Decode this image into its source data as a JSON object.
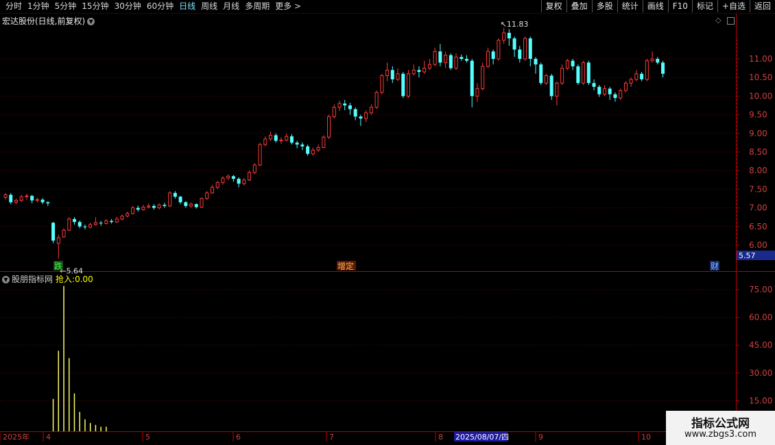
{
  "toolbar": {
    "periods": [
      "分时",
      "1分钟",
      "5分钟",
      "15分钟",
      "30分钟",
      "60分钟",
      "日线",
      "周线",
      "月线",
      "多周期",
      "更多 >"
    ],
    "active_period": "日线",
    "buttons": [
      "复权",
      "叠加",
      "多股",
      "统计",
      "画线",
      "F10",
      "标记",
      "+自选",
      "返回"
    ]
  },
  "chart_title": "宏达股份(日线,前复权)",
  "indicator": {
    "name": "股朋指标网",
    "label": "抢入:",
    "value": "0.00"
  },
  "price_axis_labels": [
    "11.00",
    "10.50",
    "10.00",
    "9.50",
    "9.00",
    "8.50",
    "8.00",
    "7.50",
    "7.00",
    "6.50",
    "6.00"
  ],
  "indicator_axis_labels": [
    "75.00",
    "60.00",
    "45.00",
    "30.00",
    "15.00"
  ],
  "current_price_tag": "5.57",
  "high_annotation": "11.83",
  "low_annotation": "5.64",
  "markers": {
    "die": "跌",
    "zengding": "增定",
    "cai": "财"
  },
  "date_axis": {
    "labels": [
      "2025年",
      "4",
      "5",
      "6",
      "7",
      "8",
      "9",
      "10"
    ],
    "cursor_date": "2025/08/07/四"
  },
  "watermark": {
    "line1": "指标公式网",
    "line2": "www.zbgs3.com"
  },
  "colors": {
    "up": "#ff3b3b",
    "down": "#54ffff",
    "grid": "#7a0000",
    "axis": "#c00000",
    "volume": "#ffff66"
  },
  "chart_data": {
    "type": "candlestick",
    "y_axis": {
      "min": 5.5,
      "max": 12.0
    },
    "candles": [
      [
        7.28,
        7.35,
        7.22,
        7.4
      ],
      [
        7.35,
        7.15,
        7.1,
        7.4
      ],
      [
        7.15,
        7.2,
        7.1,
        7.25
      ],
      [
        7.2,
        7.3,
        7.15,
        7.35
      ],
      [
        7.3,
        7.32,
        7.22,
        7.38
      ],
      [
        7.32,
        7.2,
        7.12,
        7.35
      ],
      [
        7.2,
        7.22,
        7.15,
        7.28
      ],
      [
        7.22,
        7.15,
        7.1,
        7.26
      ],
      [
        7.15,
        7.12,
        7.05,
        7.18
      ],
      [
        6.6,
        6.12,
        6.05,
        6.62
      ],
      [
        6.05,
        6.2,
        5.64,
        6.28
      ],
      [
        6.22,
        6.4,
        6.2,
        6.45
      ],
      [
        6.4,
        6.7,
        6.38,
        6.75
      ],
      [
        6.7,
        6.62,
        6.55,
        6.75
      ],
      [
        6.62,
        6.5,
        6.45,
        6.66
      ],
      [
        6.5,
        6.48,
        6.42,
        6.55
      ],
      [
        6.48,
        6.55,
        6.45,
        6.6
      ],
      [
        6.55,
        6.6,
        6.52,
        6.75
      ],
      [
        6.6,
        6.58,
        6.52,
        6.65
      ],
      [
        6.58,
        6.65,
        6.55,
        6.7
      ],
      [
        6.65,
        6.62,
        6.58,
        6.7
      ],
      [
        6.62,
        6.7,
        6.6,
        6.76
      ],
      [
        6.7,
        6.78,
        6.66,
        6.82
      ],
      [
        6.78,
        6.85,
        6.74,
        6.9
      ],
      [
        6.85,
        7.0,
        6.82,
        7.05
      ],
      [
        7.0,
        6.95,
        6.9,
        7.06
      ],
      [
        6.95,
        7.02,
        6.92,
        7.08
      ],
      [
        7.02,
        7.05,
        6.98,
        7.12
      ],
      [
        7.05,
        7.0,
        6.95,
        7.1
      ],
      [
        7.0,
        7.08,
        6.96,
        7.12
      ],
      [
        7.08,
        7.05,
        7.0,
        7.14
      ],
      [
        7.05,
        7.4,
        7.02,
        7.45
      ],
      [
        7.4,
        7.3,
        7.25,
        7.45
      ],
      [
        7.3,
        7.15,
        7.1,
        7.32
      ],
      [
        7.15,
        7.05,
        7.0,
        7.18
      ],
      [
        7.05,
        7.1,
        7.0,
        7.15
      ],
      [
        7.1,
        7.02,
        6.98,
        7.12
      ],
      [
        7.02,
        7.25,
        7.0,
        7.28
      ],
      [
        7.25,
        7.4,
        7.22,
        7.45
      ],
      [
        7.4,
        7.55,
        7.38,
        7.62
      ],
      [
        7.55,
        7.68,
        7.5,
        7.72
      ],
      [
        7.68,
        7.8,
        7.62,
        7.85
      ],
      [
        7.8,
        7.85,
        7.75,
        7.9
      ],
      [
        7.85,
        7.78,
        7.7,
        7.88
      ],
      [
        7.78,
        7.65,
        7.55,
        7.82
      ],
      [
        7.65,
        7.75,
        7.6,
        7.8
      ],
      [
        7.75,
        7.95,
        7.72,
        8.0
      ],
      [
        7.95,
        8.15,
        7.9,
        8.2
      ],
      [
        8.15,
        8.7,
        8.12,
        8.75
      ],
      [
        8.7,
        8.85,
        8.65,
        8.92
      ],
      [
        8.85,
        8.95,
        8.8,
        9.05
      ],
      [
        8.95,
        8.8,
        8.75,
        9.0
      ],
      [
        8.8,
        8.82,
        8.72,
        8.9
      ],
      [
        8.82,
        8.92,
        8.78,
        9.0
      ],
      [
        8.92,
        8.75,
        8.7,
        8.98
      ],
      [
        8.75,
        8.7,
        8.6,
        8.8
      ],
      [
        8.7,
        8.65,
        8.55,
        8.76
      ],
      [
        8.65,
        8.45,
        8.4,
        8.7
      ],
      [
        8.45,
        8.55,
        8.4,
        8.62
      ],
      [
        8.55,
        8.62,
        8.5,
        8.7
      ],
      [
        8.62,
        8.9,
        8.6,
        8.95
      ],
      [
        8.9,
        9.45,
        8.85,
        9.5
      ],
      [
        9.45,
        9.7,
        9.4,
        9.78
      ],
      [
        9.7,
        9.8,
        9.6,
        9.88
      ],
      [
        9.8,
        9.75,
        9.62,
        9.9
      ],
      [
        9.75,
        9.65,
        9.5,
        9.82
      ],
      [
        9.65,
        9.45,
        9.35,
        9.7
      ],
      [
        9.45,
        9.4,
        9.2,
        9.5
      ],
      [
        9.4,
        9.55,
        9.3,
        9.62
      ],
      [
        9.55,
        9.7,
        9.5,
        9.78
      ],
      [
        9.7,
        10.1,
        9.65,
        10.15
      ],
      [
        10.1,
        10.55,
        10.05,
        10.6
      ],
      [
        10.55,
        10.7,
        10.4,
        10.9
      ],
      [
        10.7,
        10.45,
        10.35,
        10.8
      ],
      [
        10.45,
        10.6,
        10.4,
        10.75
      ],
      [
        10.6,
        10.0,
        9.95,
        10.65
      ],
      [
        10.0,
        10.6,
        9.95,
        10.7
      ],
      [
        10.6,
        10.7,
        10.55,
        10.85
      ],
      [
        10.7,
        10.65,
        10.5,
        10.8
      ],
      [
        10.65,
        10.75,
        10.6,
        10.95
      ],
      [
        10.75,
        10.85,
        10.7,
        11.0
      ],
      [
        10.85,
        11.2,
        10.8,
        11.3
      ],
      [
        11.2,
        10.9,
        10.8,
        11.4
      ],
      [
        10.9,
        11.1,
        10.75,
        11.2
      ],
      [
        11.1,
        10.75,
        10.7,
        11.15
      ],
      [
        10.75,
        11.05,
        10.7,
        11.15
      ],
      [
        11.05,
        11.0,
        10.95,
        11.12
      ],
      [
        11.0,
        10.95,
        10.9,
        11.1
      ],
      [
        10.95,
        10.0,
        9.7,
        11.0
      ],
      [
        10.0,
        10.2,
        9.85,
        10.35
      ],
      [
        10.2,
        10.8,
        10.15,
        10.9
      ],
      [
        10.8,
        11.2,
        10.75,
        11.3
      ],
      [
        11.2,
        11.0,
        10.85,
        11.25
      ],
      [
        11.0,
        11.5,
        10.95,
        11.55
      ],
      [
        11.5,
        11.7,
        11.4,
        11.83
      ],
      [
        11.7,
        11.55,
        11.35,
        11.8
      ],
      [
        11.55,
        11.25,
        11.05,
        11.6
      ],
      [
        11.25,
        11.0,
        10.9,
        11.35
      ],
      [
        11.0,
        11.55,
        10.95,
        11.6
      ],
      [
        11.55,
        11.0,
        10.8,
        11.6
      ],
      [
        11.0,
        10.85,
        10.6,
        11.05
      ],
      [
        10.85,
        10.35,
        10.3,
        10.9
      ],
      [
        10.35,
        10.55,
        10.3,
        10.6
      ],
      [
        10.55,
        10.0,
        9.9,
        10.6
      ],
      [
        10.0,
        10.35,
        9.75,
        10.4
      ],
      [
        10.35,
        10.75,
        10.3,
        10.85
      ],
      [
        10.75,
        10.95,
        10.7,
        11.0
      ],
      [
        10.95,
        10.8,
        10.7,
        11.0
      ],
      [
        10.8,
        10.35,
        10.3,
        10.85
      ],
      [
        10.35,
        10.9,
        10.3,
        10.95
      ],
      [
        10.9,
        10.35,
        10.3,
        10.95
      ],
      [
        10.35,
        10.25,
        10.15,
        10.45
      ],
      [
        10.25,
        10.05,
        9.98,
        10.3
      ],
      [
        10.05,
        10.2,
        10.0,
        10.3
      ],
      [
        10.2,
        10.05,
        9.9,
        10.25
      ],
      [
        10.05,
        9.95,
        9.85,
        10.1
      ],
      [
        9.95,
        10.15,
        9.9,
        10.2
      ],
      [
        10.15,
        10.35,
        10.1,
        10.4
      ],
      [
        10.35,
        10.45,
        10.25,
        10.5
      ],
      [
        10.45,
        10.6,
        10.4,
        10.7
      ],
      [
        10.6,
        10.45,
        10.4,
        10.65
      ],
      [
        10.45,
        10.95,
        10.4,
        11.0
      ],
      [
        10.95,
        11.0,
        10.9,
        11.2
      ],
      [
        11.0,
        10.9,
        10.85,
        11.05
      ],
      [
        10.9,
        10.6,
        10.5,
        10.95
      ]
    ],
    "indicator": {
      "name": "抢入",
      "values": [
        0,
        0,
        0,
        0,
        0,
        0,
        0,
        0,
        0,
        16,
        42,
        77,
        38,
        19,
        9,
        5,
        3,
        2,
        1,
        1,
        0,
        0,
        0,
        0,
        0,
        0,
        0,
        0,
        0,
        0,
        0,
        0,
        0,
        0,
        0,
        0,
        0,
        0,
        0,
        0,
        0,
        0,
        0,
        0,
        0,
        0,
        0,
        0,
        0,
        0,
        0,
        0,
        0,
        0,
        0,
        0,
        0,
        0,
        0,
        0,
        0,
        0,
        0,
        0,
        0,
        0,
        0,
        0,
        0,
        0,
        0,
        0,
        0,
        0,
        0,
        0,
        0,
        0,
        0,
        0,
        0,
        0,
        0,
        0,
        0,
        0,
        0,
        0,
        0,
        0,
        0,
        0,
        0,
        0,
        0,
        0,
        0,
        0,
        0,
        0,
        0,
        0,
        0,
        0,
        0,
        0,
        0,
        0,
        0,
        0,
        0,
        0,
        0,
        0,
        0,
        0,
        0,
        0,
        0,
        0,
        0,
        0,
        0,
        0,
        0,
        0,
        0,
        0,
        0,
        0,
        0,
        0
      ],
      "ylim": [
        0,
        80
      ]
    }
  }
}
